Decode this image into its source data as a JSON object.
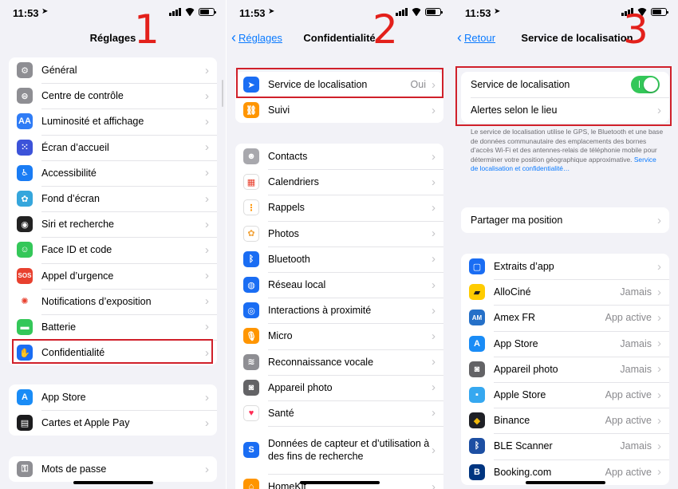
{
  "status": {
    "time": "11:53"
  },
  "panel1": {
    "nav_title": "Réglages",
    "step": "1",
    "group_a": [
      {
        "label": "Général",
        "icon": "gear-icon",
        "color": "#8e8e93",
        "glyph": "⚙"
      },
      {
        "label": "Centre de contrôle",
        "icon": "toggles-icon",
        "color": "#8e8e93",
        "glyph": "⊜"
      },
      {
        "label": "Luminosité et affichage",
        "icon": "aa-icon",
        "color": "#2f7cf6",
        "glyph": "AA"
      },
      {
        "label": "Écran d’accueil",
        "icon": "grid-icon",
        "color": "#3c53d9",
        "glyph": "⁙"
      },
      {
        "label": "Accessibilité",
        "icon": "accessibility-icon",
        "color": "#1a7cf4",
        "glyph": "♿"
      },
      {
        "label": "Fond d’écran",
        "icon": "flower-icon",
        "color": "#35a6dc",
        "glyph": "✿"
      },
      {
        "label": "Siri et recherche",
        "icon": "siri-icon",
        "color": "#222222",
        "glyph": "◉"
      },
      {
        "label": "Face ID et code",
        "icon": "face-id-icon",
        "color": "#34c759",
        "glyph": "☺"
      },
      {
        "label": "Appel d’urgence",
        "icon": "sos-icon",
        "color": "#e8412f",
        "glyph": "SOS"
      },
      {
        "label": "Notifications d’exposition",
        "icon": "exposure-icon",
        "color": "#ffffff",
        "glyph": "✺"
      },
      {
        "label": "Batterie",
        "icon": "battery-icon",
        "color": "#34c759",
        "glyph": "▬"
      },
      {
        "label": "Confidentialité",
        "icon": "hand-icon",
        "color": "#1a6df3",
        "glyph": "✋"
      }
    ],
    "group_b": [
      {
        "label": "App Store",
        "icon": "app-store-icon",
        "color": "#1a8cf6",
        "glyph": "A"
      },
      {
        "label": "Cartes et Apple Pay",
        "icon": "wallet-icon",
        "color": "#1c1c1e",
        "glyph": "▤"
      }
    ],
    "group_c": [
      {
        "label": "Mots de passe",
        "icon": "key-icon",
        "color": "#8e8e93",
        "glyph": "⚿"
      }
    ]
  },
  "panel2": {
    "back_label": "Réglages",
    "nav_title": "Confidentialité",
    "step": "2",
    "group_a": [
      {
        "label": "Service de localisation",
        "value": "Oui",
        "icon": "location-arrow-icon",
        "color": "#1a6df3",
        "glyph": "➤"
      },
      {
        "label": "Suivi",
        "icon": "tracking-icon",
        "color": "#ff9500",
        "glyph": "⛓"
      }
    ],
    "group_b": [
      {
        "label": "Contacts",
        "icon": "contacts-icon",
        "color": "#a8a8ad",
        "glyph": "☻"
      },
      {
        "label": "Calendriers",
        "icon": "calendar-icon",
        "color": "#ffffff",
        "glyph": "▦"
      },
      {
        "label": "Rappels",
        "icon": "reminders-icon",
        "color": "#ffffff",
        "glyph": "⋮"
      },
      {
        "label": "Photos",
        "icon": "photos-icon",
        "color": "#ffffff",
        "glyph": "✿"
      },
      {
        "label": "Bluetooth",
        "icon": "bluetooth-icon",
        "color": "#1a6df3",
        "glyph": "ᛒ"
      },
      {
        "label": "Réseau local",
        "icon": "globe-icon",
        "color": "#1a6df3",
        "glyph": "◍"
      },
      {
        "label": "Interactions à proximité",
        "icon": "nearby-icon",
        "color": "#1a6df3",
        "glyph": "◎"
      },
      {
        "label": "Micro",
        "icon": "microphone-icon",
        "color": "#ff9500",
        "glyph": "🎙"
      },
      {
        "label": "Reconnaissance vocale",
        "icon": "waveform-icon",
        "color": "#8e8e93",
        "glyph": "≋"
      },
      {
        "label": "Appareil photo",
        "icon": "camera-icon",
        "color": "#636366",
        "glyph": "◙"
      },
      {
        "label": "Santé",
        "icon": "heart-icon",
        "color": "#ffffff",
        "glyph": "♥"
      },
      {
        "label": "Données de capteur et d’utilisation à des fins de recherche",
        "icon": "research-icon",
        "color": "#1a6df3",
        "glyph": "S"
      },
      {
        "label": "HomeKit",
        "icon": "home-icon",
        "color": "#ff9500",
        "glyph": "⌂"
      }
    ]
  },
  "panel3": {
    "back_label": "Retour",
    "nav_title": "Service de localisation",
    "step": "3",
    "group_a": [
      {
        "label": "Service de localisation",
        "control": "toggle",
        "state": "on"
      },
      {
        "label": "Alertes selon le lieu"
      }
    ],
    "description": "Le service de localisation utilise le GPS, le Bluetooth et une base de données communautaire des emplacements des bornes d’accès Wi-Fi et des antennes-relais de téléphonie mobile pour déterminer votre position géographique approximative.",
    "description_link": "Service de localisation et confidentialité…",
    "group_b": [
      {
        "label": "Partager ma position"
      }
    ],
    "group_c": [
      {
        "label": "Extraits d’app",
        "value": "",
        "icon": "app-clip-icon",
        "color": "#1a6df3",
        "glyph": "▢"
      },
      {
        "label": "AlloCiné",
        "value": "Jamais",
        "icon": "allocine-icon",
        "color": "#ffcc00",
        "glyph": "▰"
      },
      {
        "label": "Amex FR",
        "value": "App active",
        "icon": "amex-icon",
        "color": "#2570c8",
        "glyph": "AM"
      },
      {
        "label": "App Store",
        "value": "Jamais",
        "icon": "app-store-icon",
        "color": "#1a8cf6",
        "glyph": "A"
      },
      {
        "label": "Appareil photo",
        "value": "Jamais",
        "icon": "camera-icon",
        "color": "#636366",
        "glyph": "◙"
      },
      {
        "label": "Apple Store",
        "value": "App active",
        "icon": "apple-store-icon",
        "color": "#36a8f0",
        "glyph": "▪"
      },
      {
        "label": "Binance",
        "value": "App active",
        "icon": "binance-icon",
        "color": "#1e2026",
        "glyph": "◆"
      },
      {
        "label": "BLE Scanner",
        "value": "Jamais",
        "icon": "ble-scanner-icon",
        "color": "#1d4fa3",
        "glyph": "ᛒ"
      },
      {
        "label": "Booking.com",
        "value": "App active",
        "icon": "booking-icon",
        "color": "#003580",
        "glyph": "B"
      }
    ]
  }
}
